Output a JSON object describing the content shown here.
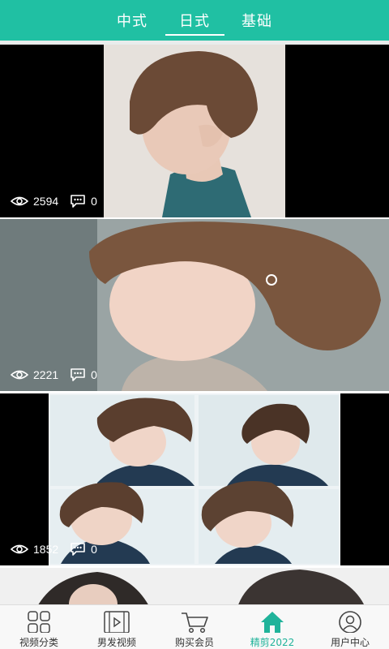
{
  "header": {
    "tabs": [
      {
        "label": "中式"
      },
      {
        "label": "日式"
      },
      {
        "label": "基础"
      }
    ],
    "active_tab": "日式"
  },
  "feed": {
    "cards": [
      {
        "views": "2594",
        "comments": "0"
      },
      {
        "views": "2221",
        "comments": "0"
      },
      {
        "views": "1852",
        "comments": "0"
      }
    ]
  },
  "bottom_nav": {
    "items": [
      {
        "label": "视频分类",
        "icon": "grid-icon"
      },
      {
        "label": "男发视频",
        "icon": "film-icon"
      },
      {
        "label": "购买会员",
        "icon": "cart-icon"
      },
      {
        "label": "精剪2022",
        "icon": "home-icon"
      },
      {
        "label": "用户中心",
        "icon": "user-icon"
      }
    ],
    "active": "精剪2022"
  },
  "colors": {
    "accent": "#20c0a3",
    "nav_active": "#20b39a"
  }
}
